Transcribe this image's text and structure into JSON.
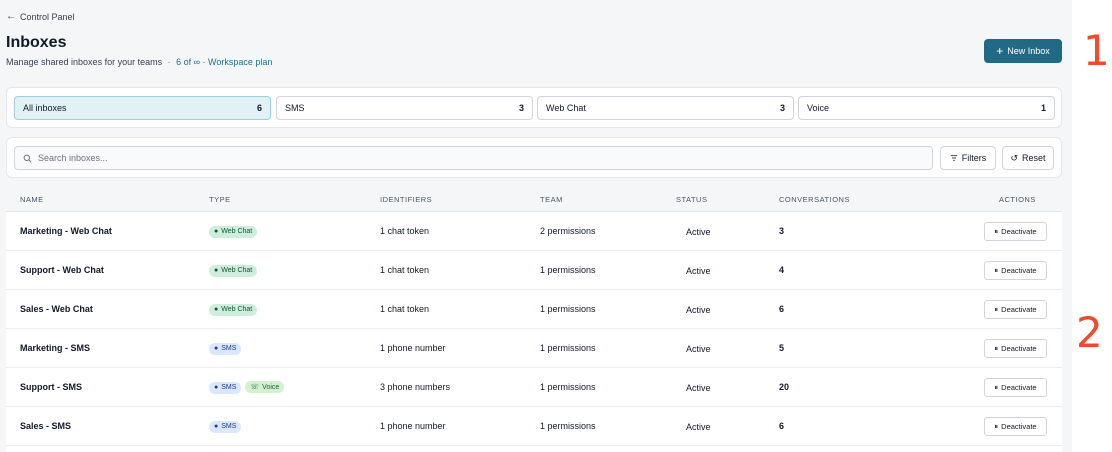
{
  "breadcrumb": {
    "back_label": "Control Panel"
  },
  "header": {
    "title": "Inboxes",
    "subtitle": "Manage shared inboxes for your teams",
    "separator": "·",
    "plan_text": "6 of ∞ · Workspace plan",
    "new_inbox_label": "New Inbox"
  },
  "tabs": [
    {
      "label": "All inboxes",
      "count": "6",
      "active": true
    },
    {
      "label": "SMS",
      "count": "3"
    },
    {
      "label": "Web Chat",
      "count": "3"
    },
    {
      "label": "Voice",
      "count": "1"
    }
  ],
  "search": {
    "placeholder": "Search inboxes...",
    "filters_label": "Filters",
    "reset_label": "Reset"
  },
  "table": {
    "headers": [
      "NAME",
      "TYPE",
      "IDENTIFIERS",
      "TEAM",
      "STATUS",
      "CONVERSATIONS",
      "ACTIONS"
    ],
    "action_label": "Deactivate",
    "rows": [
      {
        "name": "Marketing - Web Chat",
        "types": [
          "Web Chat"
        ],
        "identifiers": "1 chat token",
        "team": "2 permissions",
        "status": "Active",
        "conversations": "3"
      },
      {
        "name": "Support - Web Chat",
        "types": [
          "Web Chat"
        ],
        "identifiers": "1 chat token",
        "team": "1 permissions",
        "status": "Active",
        "conversations": "4"
      },
      {
        "name": "Sales - Web Chat",
        "types": [
          "Web Chat"
        ],
        "identifiers": "1 chat token",
        "team": "1 permissions",
        "status": "Active",
        "conversations": "6"
      },
      {
        "name": "Marketing - SMS",
        "types": [
          "SMS"
        ],
        "identifiers": "1 phone number",
        "team": "1 permissions",
        "status": "Active",
        "conversations": "5"
      },
      {
        "name": "Support - SMS",
        "types": [
          "SMS",
          "Voice"
        ],
        "identifiers": "3 phone numbers",
        "team": "1 permissions",
        "status": "Active",
        "conversations": "20"
      },
      {
        "name": "Sales - SMS",
        "types": [
          "SMS"
        ],
        "identifiers": "1 phone number",
        "team": "1 permissions",
        "status": "Active",
        "conversations": "6"
      }
    ]
  },
  "markers": [
    "1",
    "2"
  ],
  "colors": {
    "primary": "#216a86",
    "accent_marker": "#ef4b2f",
    "webchat_badge": "#cdeedd",
    "sms_badge": "#dbe7ff",
    "voice_badge": "#d3f0cf"
  }
}
